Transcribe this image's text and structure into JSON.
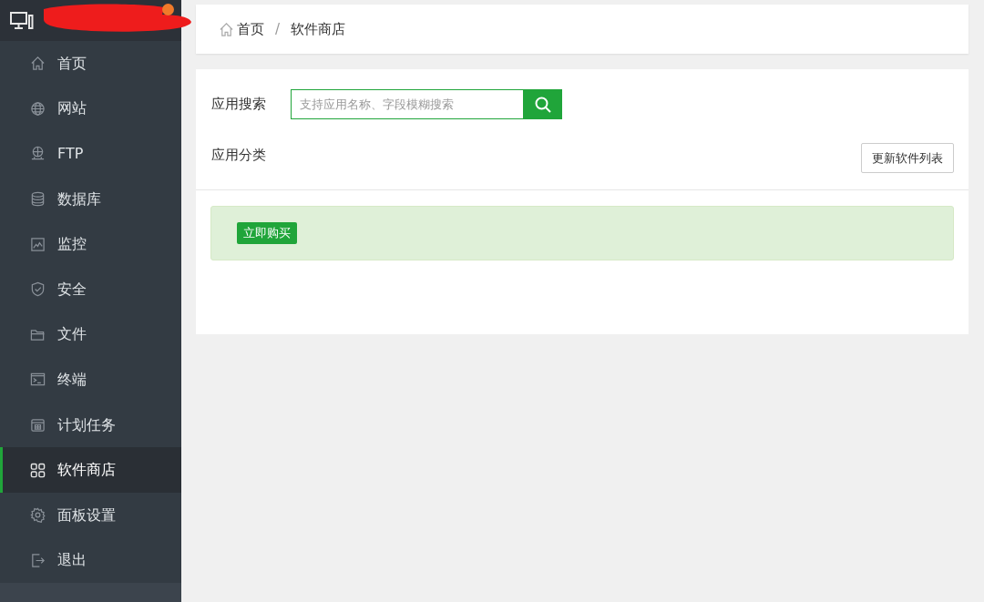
{
  "sidebar": {
    "items": [
      {
        "label": "首页",
        "selected": false
      },
      {
        "label": "网站",
        "selected": false
      },
      {
        "label": "FTP",
        "selected": false
      },
      {
        "label": "数据库",
        "selected": false
      },
      {
        "label": "监控",
        "selected": false
      },
      {
        "label": "安全",
        "selected": false
      },
      {
        "label": "文件",
        "selected": false
      },
      {
        "label": "终端",
        "selected": false
      },
      {
        "label": "计划任务",
        "selected": false
      },
      {
        "label": "软件商店",
        "selected": true
      },
      {
        "label": "面板设置",
        "selected": false
      },
      {
        "label": "退出",
        "selected": false
      }
    ]
  },
  "breadcrumb": [
    "首页",
    "软件商店"
  ],
  "breadcrumb_separator": "/",
  "search": {
    "label": "应用搜索",
    "placeholder": "支持应用名称、字段模糊搜索"
  },
  "category": {
    "label": "应用分类"
  },
  "refresh_button": "更新软件列表",
  "notice": {
    "button": "立即购买"
  }
}
